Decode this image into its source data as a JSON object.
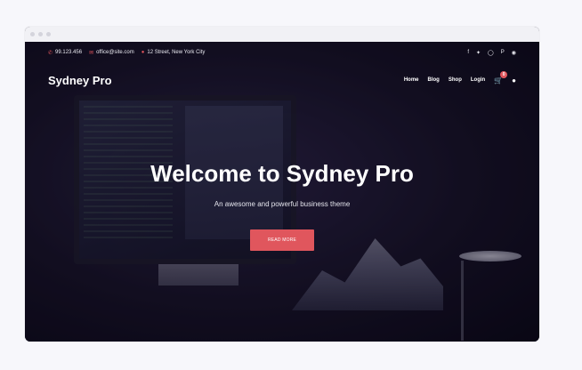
{
  "topbar": {
    "phone": "99.123.456",
    "email": "office@site.com",
    "address": "12 Street, New York City",
    "social_icons": [
      "facebook-icon",
      "twitter-icon",
      "instagram-icon",
      "pinterest-icon",
      "dribbble-icon"
    ]
  },
  "nav": {
    "brand": "Sydney Pro",
    "items": [
      "Home",
      "Blog",
      "Shop",
      "Login"
    ],
    "cart_count": "0"
  },
  "hero": {
    "title": "Welcome to Sydney Pro",
    "subtitle": "An awesome and powerful business theme",
    "button_label": "READ MORE"
  },
  "colors": {
    "accent": "#e0565d",
    "background": "#0b0a18",
    "page": "#f7f7fb"
  }
}
